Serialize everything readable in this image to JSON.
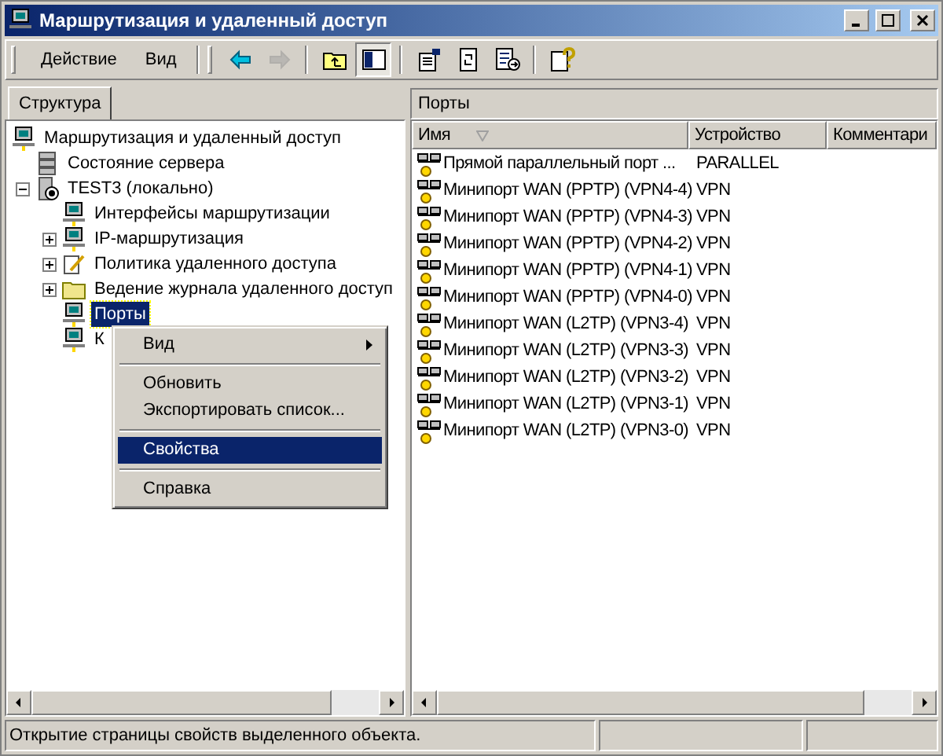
{
  "window": {
    "title": "Маршрутизация и удаленный доступ"
  },
  "menu": [
    {
      "label": "Действие"
    },
    {
      "label": "Вид"
    }
  ],
  "toolbar": [
    {
      "kind": "back",
      "disabled": false,
      "pressed": false
    },
    {
      "kind": "forward",
      "disabled": true,
      "pressed": false
    },
    {
      "kind": "sep"
    },
    {
      "kind": "up",
      "disabled": false,
      "pressed": false
    },
    {
      "kind": "tree",
      "disabled": false,
      "pressed": true
    },
    {
      "kind": "sep"
    },
    {
      "kind": "properties",
      "disabled": false,
      "pressed": false
    },
    {
      "kind": "refresh",
      "disabled": false,
      "pressed": false
    },
    {
      "kind": "export",
      "disabled": false,
      "pressed": false
    },
    {
      "kind": "sep"
    },
    {
      "kind": "help",
      "disabled": false,
      "pressed": false
    }
  ],
  "left_tab": {
    "label": "Структура",
    "selected": true
  },
  "tree": [
    {
      "label": "Маршрутизация и удаленный доступ",
      "kind": "computer",
      "selected": false,
      "children": [
        {
          "label": "Состояние сервера",
          "kind": "servers",
          "selected": false
        },
        {
          "label": "TEST3 (локально)",
          "kind": "server",
          "selected": false,
          "expanded": true,
          "children": [
            {
              "label": "Интерфейсы маршрутизации",
              "kind": "computer",
              "selected": false
            },
            {
              "label": "IP-маршрутизация",
              "kind": "computer",
              "selected": false,
              "expanded": false
            },
            {
              "label": "Политика удаленного доступа",
              "kind": "policy",
              "selected": false,
              "expanded": false
            },
            {
              "label": "Ведение журнала удаленного доступ",
              "kind": "folder",
              "selected": false,
              "expanded": false
            },
            {
              "label": "Порты",
              "kind": "computer",
              "selected": true
            },
            {
              "label": "К",
              "kind": "computer",
              "selected": false
            }
          ]
        }
      ]
    }
  ],
  "context_menu": [
    {
      "kind": "item",
      "label": "Вид",
      "submenu": true,
      "selected": false
    },
    {
      "kind": "separator"
    },
    {
      "kind": "item",
      "label": "Обновить",
      "submenu": false,
      "selected": false
    },
    {
      "kind": "item",
      "label": "Экспортировать список...",
      "submenu": false,
      "selected": false
    },
    {
      "kind": "separator"
    },
    {
      "kind": "item",
      "label": "Свойства",
      "submenu": false,
      "selected": true
    },
    {
      "kind": "separator"
    },
    {
      "kind": "item",
      "label": "Справка",
      "submenu": false,
      "selected": false
    }
  ],
  "right_pane": {
    "title": "Порты",
    "columns": [
      {
        "label": "Имя",
        "sorted": true
      },
      {
        "label": "Устройство",
        "sorted": false
      },
      {
        "label": "Комментари",
        "sorted": false
      }
    ],
    "rows": [
      {
        "name": "Прямой параллельный порт ...",
        "device": "PARALLEL"
      },
      {
        "name": "Минипорт WAN (PPTP) (VPN4-4)",
        "device": "VPN"
      },
      {
        "name": "Минипорт WAN (PPTP) (VPN4-3)",
        "device": "VPN"
      },
      {
        "name": "Минипорт WAN (PPTP) (VPN4-2)",
        "device": "VPN"
      },
      {
        "name": "Минипорт WAN (PPTP) (VPN4-1)",
        "device": "VPN"
      },
      {
        "name": "Минипорт WAN (PPTP) (VPN4-0)",
        "device": "VPN"
      },
      {
        "name": "Минипорт WAN (L2TP) (VPN3-4)",
        "device": "VPN"
      },
      {
        "name": "Минипорт WAN (L2TP) (VPN3-3)",
        "device": "VPN"
      },
      {
        "name": "Минипорт WAN (L2TP) (VPN3-2)",
        "device": "VPN"
      },
      {
        "name": "Минипорт WAN (L2TP) (VPN3-1)",
        "device": "VPN"
      },
      {
        "name": "Минипорт WAN (L2TP) (VPN3-0)",
        "device": "VPN"
      }
    ]
  },
  "status_bar": {
    "text": "Открытие страницы свойств выделенного объекта."
  }
}
